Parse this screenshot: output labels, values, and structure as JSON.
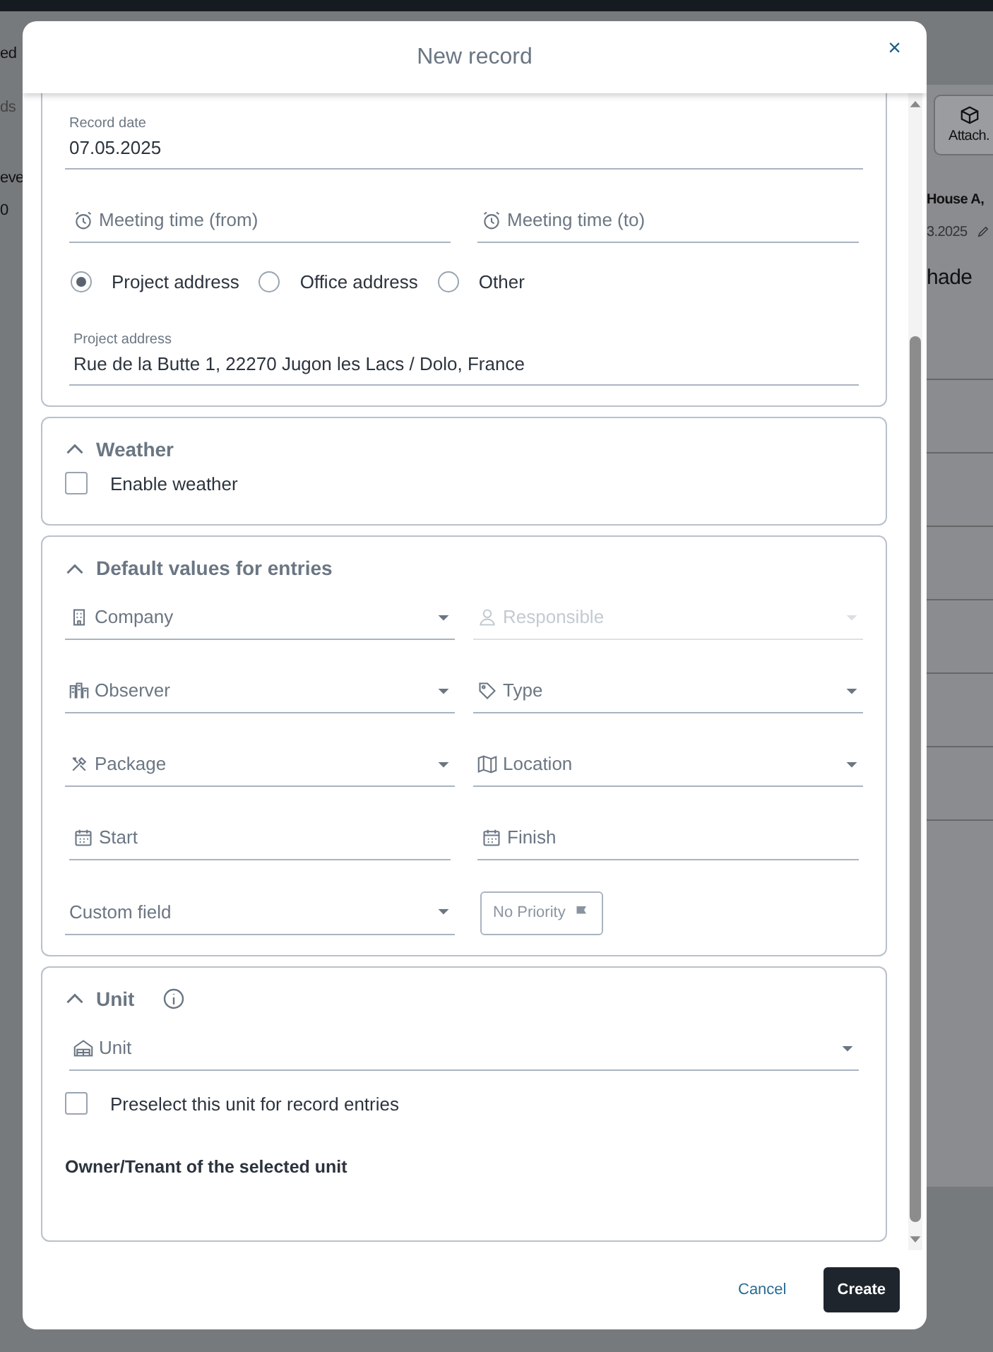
{
  "background": {
    "left_texts": [
      "ed",
      "ds",
      "eve",
      "0"
    ],
    "attach_button": "Attach.",
    "house": "House A,",
    "date": "3.2025",
    "heading": "hade"
  },
  "modal": {
    "title": "New record",
    "close": "×"
  },
  "place_time": {
    "record_date": {
      "label": "Record date",
      "value": "07.05.2025"
    },
    "meeting_times": [
      {
        "placeholder": "Meeting time (from)"
      },
      {
        "placeholder": "Meeting time (to)"
      }
    ],
    "address_options": [
      {
        "label": "Project address",
        "selected": true
      },
      {
        "label": "Office address",
        "selected": false
      },
      {
        "label": "Other",
        "selected": false
      }
    ],
    "address": {
      "label": "Project address",
      "value": "Rue de la Butte 1, 22270 Jugon les Lacs / Dolo, France"
    }
  },
  "weather": {
    "title": "Weather",
    "expanded": true,
    "enable": {
      "label": "Enable weather",
      "checked": false
    }
  },
  "defaults": {
    "title": "Default values for entries",
    "expanded": true,
    "fields": [
      {
        "kind": "select",
        "placeholder": "Company",
        "disabled": false
      },
      {
        "kind": "select",
        "placeholder": "Responsible",
        "disabled": true
      },
      {
        "kind": "select",
        "placeholder": "Observer",
        "disabled": false
      },
      {
        "kind": "select",
        "placeholder": "Type",
        "disabled": false
      },
      {
        "kind": "select",
        "placeholder": "Package",
        "disabled": false
      },
      {
        "kind": "select",
        "placeholder": "Location",
        "disabled": false
      },
      {
        "kind": "date",
        "placeholder": "Start",
        "disabled": false
      },
      {
        "kind": "date",
        "placeholder": "Finish",
        "disabled": false
      },
      {
        "kind": "select",
        "placeholder": "Custom field",
        "disabled": false
      },
      {
        "kind": "priority",
        "placeholder": "No Priority"
      }
    ]
  },
  "unit": {
    "title": "Unit",
    "expanded": true,
    "field": {
      "placeholder": "Unit"
    },
    "preselect": {
      "label": "Preselect this unit for record entries",
      "checked": false
    },
    "owner_heading": "Owner/Tenant of the selected unit"
  },
  "footer": {
    "cancel": "Cancel",
    "create": "Create"
  }
}
